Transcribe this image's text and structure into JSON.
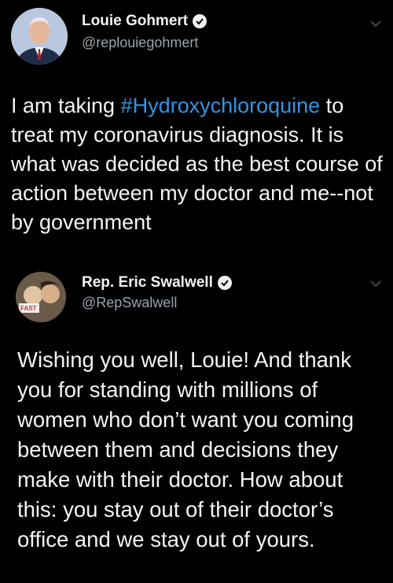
{
  "tweet": {
    "author_name": "Louie Gohmert",
    "author_handle": "@replouiegohmert",
    "text_before": "I am taking ",
    "hashtag": "#Hydroxychloroquine",
    "text_after": " to treat my coronavirus diagnosis. It is what was decided as the best course of action between my doctor and me--not by government"
  },
  "reply": {
    "author_name": "Rep. Eric Swalwell",
    "author_handle": "@RepSwalwell",
    "text": "Wishing you well, Louie! And thank you for standing with millions of women who don’t want you coming between them and decisions they make with their doctor. How about this: you stay out of their doctor’s office and we stay out of yours."
  },
  "colors": {
    "background": "#000000",
    "text": "#f4f4f4",
    "handle": "#9aa3ab",
    "hashtag": "#2f95e6"
  },
  "icons": [
    "verified-badge-icon",
    "chevron-down-icon"
  ]
}
